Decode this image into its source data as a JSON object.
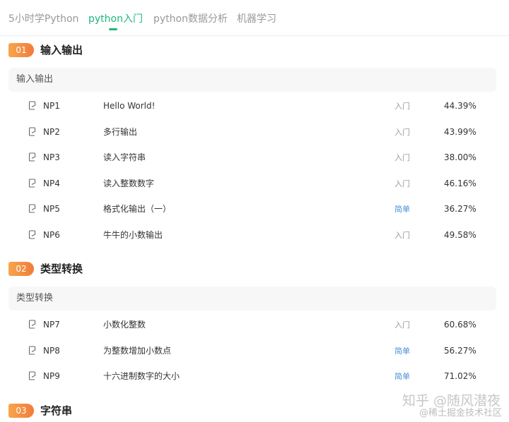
{
  "tabs": [
    {
      "label": "5小时学Python"
    },
    {
      "label": "python入门"
    },
    {
      "label": "python数据分析"
    },
    {
      "label": "机器学习"
    }
  ],
  "colors": {
    "accent_green": "#1db87c",
    "badge_orange": "#f27b3a",
    "difficulty_easy_blue": "#4a8fd9",
    "difficulty_intro_gray": "#999999"
  },
  "sections": [
    {
      "num": "01",
      "title": "输入输出",
      "group": "输入输出",
      "problems": [
        {
          "id": "NP1",
          "title": "Hello World!",
          "difficulty": "入门",
          "rate": "44.39%"
        },
        {
          "id": "NP2",
          "title": "多行输出",
          "difficulty": "入门",
          "rate": "43.99%"
        },
        {
          "id": "NP3",
          "title": "读入字符串",
          "difficulty": "入门",
          "rate": "38.00%"
        },
        {
          "id": "NP4",
          "title": "读入整数数字",
          "difficulty": "入门",
          "rate": "46.16%"
        },
        {
          "id": "NP5",
          "title": "格式化输出（一）",
          "difficulty": "简单",
          "rate": "36.27%"
        },
        {
          "id": "NP6",
          "title": "牛牛的小数输出",
          "difficulty": "入门",
          "rate": "49.58%"
        }
      ]
    },
    {
      "num": "02",
      "title": "类型转换",
      "group": "类型转换",
      "problems": [
        {
          "id": "NP7",
          "title": "小数化整数",
          "difficulty": "入门",
          "rate": "60.68%"
        },
        {
          "id": "NP8",
          "title": "为整数增加小数点",
          "difficulty": "简单",
          "rate": "56.27%"
        },
        {
          "id": "NP9",
          "title": "十六进制数字的大小",
          "difficulty": "简单",
          "rate": "71.02%"
        }
      ]
    },
    {
      "num": "03",
      "title": "字符串"
    }
  ],
  "watermark": {
    "line1": "知乎 @随风潜夜",
    "line2": "@稀土掘金技术社区"
  },
  "icons": {
    "problem_icon": "edit-doc-icon"
  }
}
